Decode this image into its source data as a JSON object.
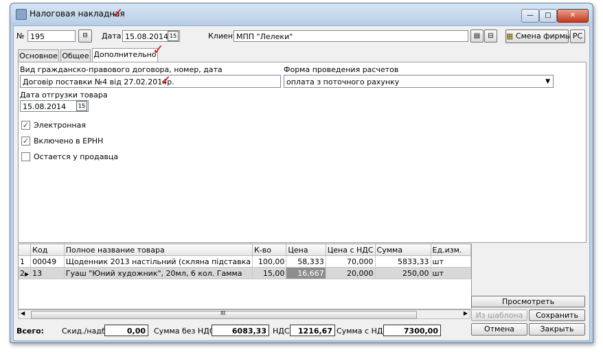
{
  "window": {
    "title": "Налоговая накладная",
    "buttons": [
      "minimize",
      "maximize",
      "close"
    ]
  },
  "header": {
    "number_label": "№",
    "number_value": "195",
    "date_label": "Дата",
    "date_value": "15.08.2014",
    "client_label": "Клиент",
    "client_value": "МПП \"Лелеки\"",
    "change_firm_label": "Смена фирмы",
    "pc_label": "РС"
  },
  "tabs": [
    {
      "label": "Основное"
    },
    {
      "label": "Общее"
    },
    {
      "label": "Дополнительно",
      "active": true
    }
  ],
  "extra": {
    "contract_label": "Вид гражданско-правового договора, номер, дата",
    "contract_value": "Договір поставки №4 від 27.02.2014р.",
    "payment_label": "Форма проведения расчетов",
    "payment_value": "оплата з поточного рахунку",
    "ship_date_label": "Дата отгрузки товара",
    "ship_date_value": "15.08.2014",
    "checkboxes": [
      {
        "label": "Электронная",
        "checked": true
      },
      {
        "label": "Включено в ЕРНН",
        "checked": true
      },
      {
        "label": "Остается у продавца",
        "checked": false
      }
    ]
  },
  "grid": {
    "columns": [
      "Код",
      "Полное название товара",
      "К-во",
      "Цена",
      "Цена с НДС",
      "Сумма",
      "Ед.изм."
    ],
    "rows": [
      {
        "n": "1",
        "code": "00049",
        "name": "Щоденник 2013 настільний (скляна підставка",
        "qty": "100,00",
        "price": "58,333",
        "price_vat": "70,000",
        "sum": "5833,33",
        "unit": "шт"
      },
      {
        "n": "2",
        "code": "13",
        "name": "Гуаш \"Юний художник\", 20мл, 6 кол. Гамма",
        "qty": "15,00",
        "price": "16,667",
        "price_vat": "20,000",
        "sum": "250,00",
        "unit": "шт"
      }
    ],
    "scroll_grip": "III"
  },
  "buttons": {
    "view": "Просмотреть",
    "from_template": "Из шаблона",
    "save": "Сохранить",
    "cancel": "Отмена",
    "close": "Закрыть"
  },
  "totals": {
    "total_label": "Всего:",
    "discount_label": "Скид./надб.",
    "discount_value": "0,00",
    "sum_no_vat_label": "Сумма без НДС",
    "sum_no_vat_value": "6083,33",
    "vat_label": "НДС",
    "vat_value": "1216,67",
    "sum_vat_label": "Сумма с НДС",
    "sum_vat_value": "7300,00"
  },
  "colors": {
    "annotation_check": "#e01010",
    "title_bar": "#bcd3ea",
    "selected_row": "#d8d8d8"
  }
}
